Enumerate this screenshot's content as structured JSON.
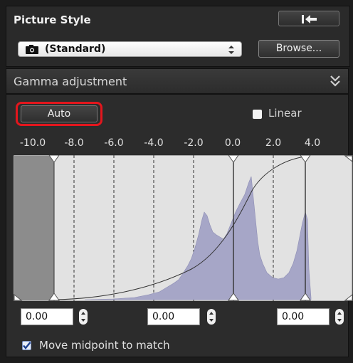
{
  "picture_style": {
    "title": "Picture Style",
    "selected_style": "(Standard)",
    "browse_label": "Browse..."
  },
  "gamma": {
    "title": "Gamma adjustment",
    "auto_label": "Auto",
    "linear_label": "Linear",
    "linear_checked": false,
    "scale": [
      "-10.0",
      "-8.0",
      "-6.0",
      "-4.0",
      "-2.0",
      "0.0",
      "2.0",
      "4.0"
    ],
    "inputs": {
      "left": "0.00",
      "middle": "0.00",
      "right": "0.00"
    },
    "move_midpoint_label": "Move midpoint to match",
    "move_midpoint_checked": true
  },
  "colors": {
    "highlight": "#e3161d",
    "histogram_fill": "#a6a6c7",
    "plot_bg": "#e2e2e2"
  },
  "icons": {
    "undo": "undo-arrow-icon",
    "camera": "camera-icon",
    "collapse": "double-chevron-down-icon",
    "stepper": "up-down-stepper-icon"
  }
}
